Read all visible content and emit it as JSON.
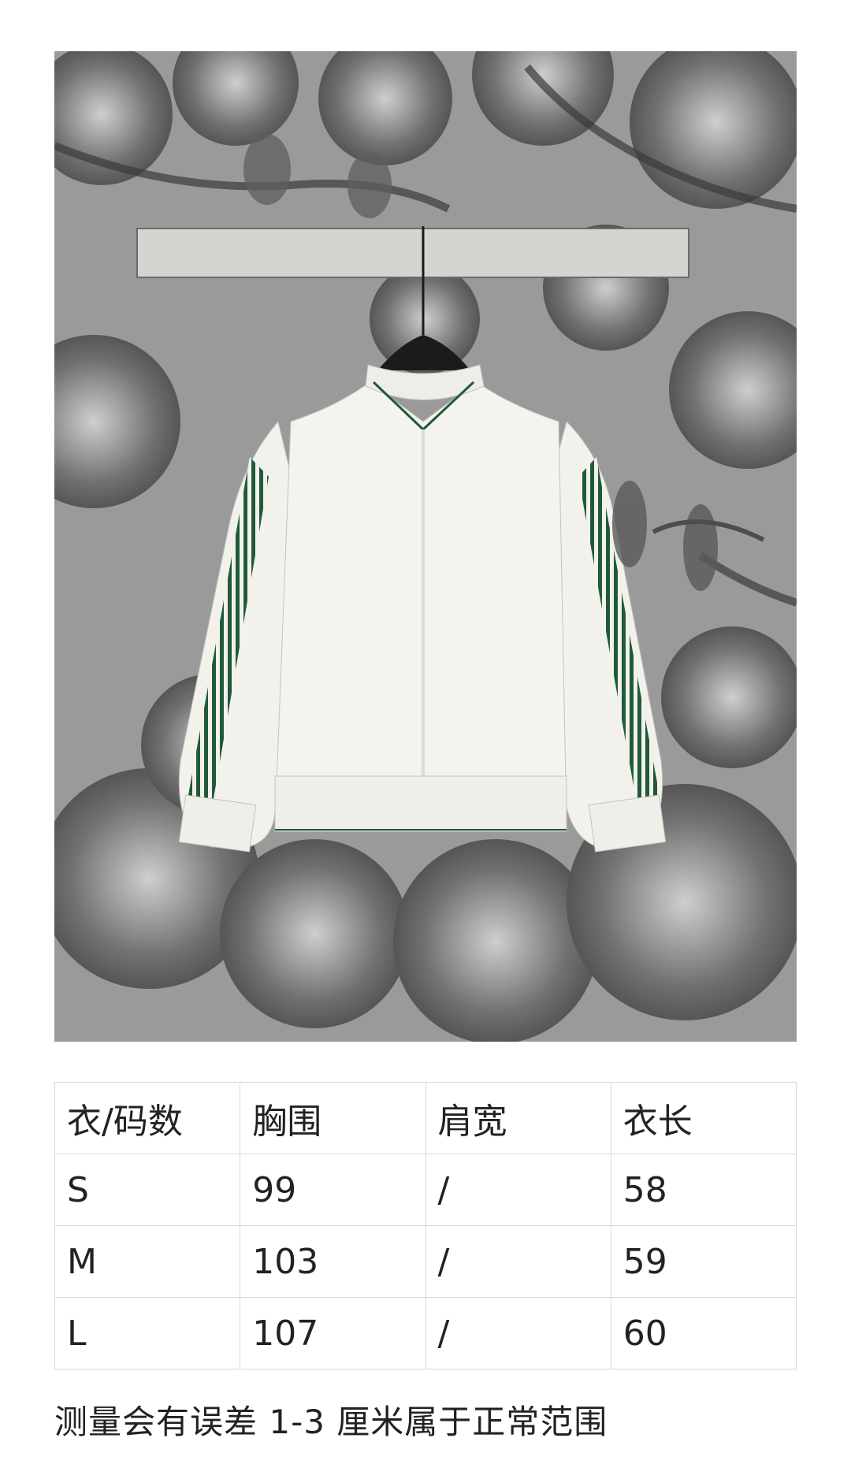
{
  "product_photo": {
    "alt": "白色拉链运动夹克，袖侧绿色条纹织带",
    "colors": {
      "wallpaper": "#8f8f8f",
      "jacket": "#f2f1ec",
      "stripe": "#1f5a3a",
      "hanger": "#1b1b1b"
    }
  },
  "size_table": {
    "headers": [
      "衣/码数",
      "胸围",
      "肩宽",
      "衣长"
    ],
    "rows": [
      [
        "S",
        "99",
        "/",
        "58"
      ],
      [
        "M",
        "103",
        "/",
        "59"
      ],
      [
        "L",
        "107",
        "/",
        "60"
      ]
    ]
  },
  "note": "测量会有误差 1-3 厘米属于正常范围"
}
